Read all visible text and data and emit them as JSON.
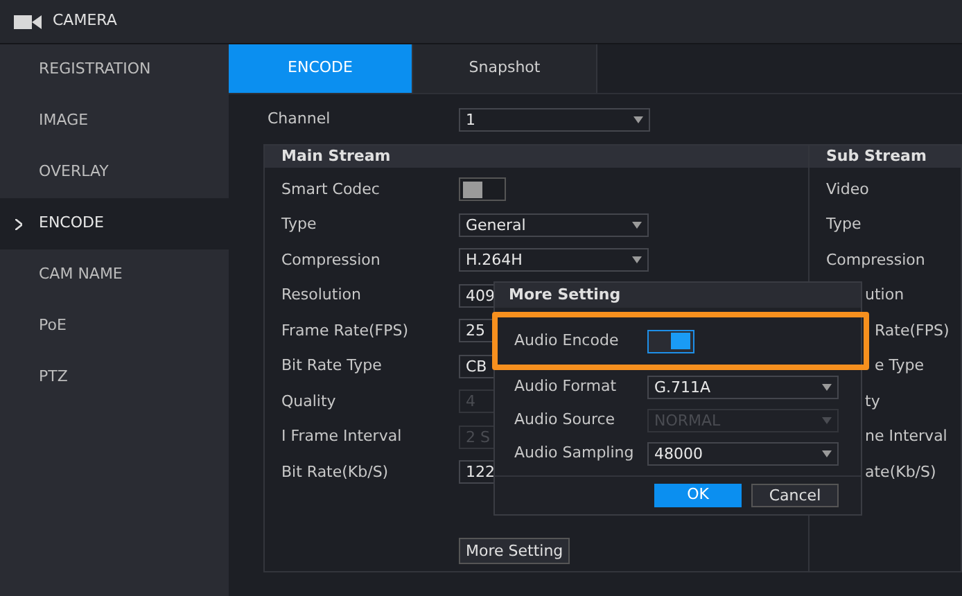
{
  "header": {
    "title": "CAMERA"
  },
  "sidebar": {
    "items": [
      {
        "label": "REGISTRATION",
        "selected": false
      },
      {
        "label": "IMAGE",
        "selected": false
      },
      {
        "label": "OVERLAY",
        "selected": false
      },
      {
        "label": "ENCODE",
        "selected": true
      },
      {
        "label": "CAM NAME",
        "selected": false
      },
      {
        "label": "PoE",
        "selected": false
      },
      {
        "label": "PTZ",
        "selected": false
      }
    ]
  },
  "tabs": [
    {
      "label": "ENCODE",
      "selected": true
    },
    {
      "label": "Snapshot",
      "selected": false
    }
  ],
  "channel": {
    "label": "Channel",
    "value": "1"
  },
  "main_stream": {
    "title": "Main Stream",
    "rows": [
      {
        "label": "Smart Codec",
        "kind": "toggle",
        "on": false
      },
      {
        "label": "Type",
        "kind": "select",
        "value": "General",
        "disabled": false
      },
      {
        "label": "Compression",
        "kind": "select",
        "value": "H.264H",
        "disabled": false
      },
      {
        "label": "Resolution",
        "kind": "select",
        "value": "409",
        "disabled": false
      },
      {
        "label": "Frame Rate(FPS)",
        "kind": "select",
        "value": "25",
        "disabled": false
      },
      {
        "label": "Bit Rate Type",
        "kind": "select",
        "value": "CB",
        "disabled": false
      },
      {
        "label": "Quality",
        "kind": "select",
        "value": "4",
        "disabled": true
      },
      {
        "label": "I Frame Interval",
        "kind": "select",
        "value": "2 S",
        "disabled": true
      },
      {
        "label": "Bit Rate(Kb/S)",
        "kind": "select",
        "value": "122",
        "disabled": false
      }
    ],
    "button": "More Setting"
  },
  "sub_stream": {
    "title": "Sub Stream",
    "rows": [
      "Video",
      "Type",
      "Compression",
      "ution",
      "Rate(FPS)",
      "e Type",
      "ty",
      "ne Interval",
      "ate(Kb/S)"
    ]
  },
  "dialog": {
    "title": "More Setting",
    "highlight": true,
    "rows": [
      {
        "label": "Audio Encode",
        "kind": "toggle",
        "on": true
      },
      {
        "label": "Audio Format",
        "kind": "select",
        "value": "G.711A",
        "disabled": false
      },
      {
        "label": "Audio Source",
        "kind": "select",
        "value": "NORMAL",
        "disabled": true
      },
      {
        "label": "Audio Sampling",
        "kind": "select",
        "value": "48000",
        "disabled": false
      }
    ],
    "buttons": [
      "OK",
      "Cancel"
    ]
  }
}
